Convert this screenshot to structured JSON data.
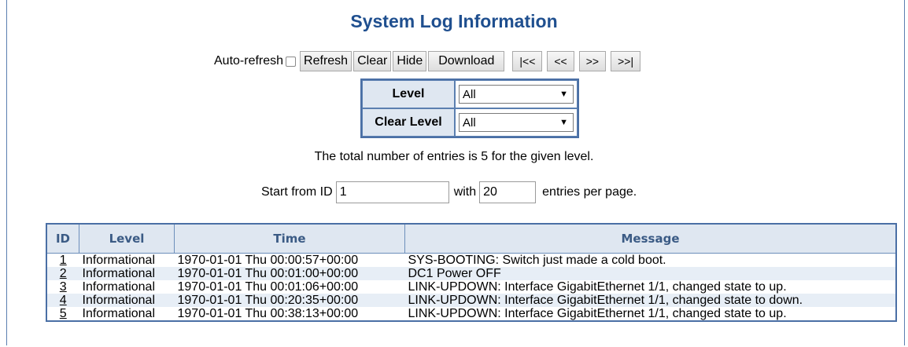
{
  "title": "System Log Information",
  "controls": {
    "auto_refresh_label": "Auto-refresh",
    "refresh": "Refresh",
    "clear": "Clear",
    "hide": "Hide",
    "download": "Download",
    "first": "|<<",
    "prev": "<<",
    "next": ">>",
    "last": ">>|"
  },
  "filters": {
    "level_label": "Level",
    "level_value": "All",
    "clear_level_label": "Clear Level",
    "clear_level_value": "All"
  },
  "summary": "The total number of entries is 5 for the given level.",
  "paging": {
    "start_label": "Start from ID",
    "start_value": "1",
    "with_label": "with",
    "with_value": "20",
    "suffix": "entries per page."
  },
  "table": {
    "headers": [
      "ID",
      "Level",
      "Time",
      "Message"
    ],
    "rows": [
      {
        "id": "1",
        "level": "Informational",
        "time": "1970-01-01 Thu 00:00:57+00:00",
        "message": "SYS-BOOTING: Switch just made a cold boot."
      },
      {
        "id": "2",
        "level": "Informational",
        "time": "1970-01-01 Thu 00:01:00+00:00",
        "message": "DC1 Power OFF"
      },
      {
        "id": "3",
        "level": "Informational",
        "time": "1970-01-01 Thu 00:01:06+00:00",
        "message": "LINK-UPDOWN: Interface GigabitEthernet 1/1, changed state to up."
      },
      {
        "id": "4",
        "level": "Informational",
        "time": "1970-01-01 Thu 00:20:35+00:00",
        "message": "LINK-UPDOWN: Interface GigabitEthernet 1/1, changed state to down."
      },
      {
        "id": "5",
        "level": "Informational",
        "time": "1970-01-01 Thu 00:38:13+00:00",
        "message": "LINK-UPDOWN: Interface GigabitEthernet 1/1, changed state to up."
      }
    ]
  }
}
